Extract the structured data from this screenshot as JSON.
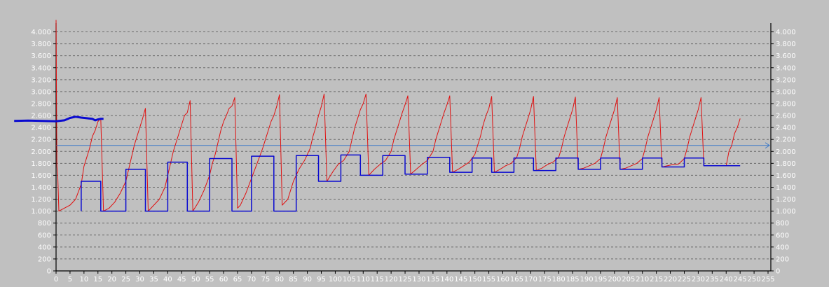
{
  "chart_data": {
    "type": "line",
    "title": "",
    "xlabel": "",
    "ylabel": "",
    "xlim": [
      0,
      256
    ],
    "ylim": [
      0,
      4100
    ],
    "grid": true,
    "x_ticks": [
      0,
      5,
      10,
      15,
      20,
      25,
      30,
      35,
      40,
      45,
      50,
      55,
      60,
      65,
      70,
      75,
      80,
      85,
      90,
      95,
      100,
      105,
      110,
      115,
      120,
      125,
      130,
      135,
      140,
      145,
      150,
      155,
      160,
      165,
      170,
      175,
      180,
      185,
      190,
      195,
      200,
      205,
      210,
      215,
      220,
      225,
      230,
      235,
      240,
      245,
      250,
      255
    ],
    "x_tick_labels": [
      "0",
      "5",
      "10",
      "15",
      "20",
      "25",
      "30",
      "35",
      "40",
      "45",
      "50",
      "55",
      "60",
      "65",
      "70",
      "75",
      "80",
      "85",
      "90",
      "95",
      "100",
      "105",
      "110",
      "115",
      "120",
      "125",
      "130",
      "135",
      "140",
      "145",
      "150",
      "155",
      "160",
      "165",
      "170",
      "175",
      "180",
      "185",
      "190",
      "195",
      "200",
      "205",
      "210",
      "215",
      "220",
      "225",
      "230",
      "235",
      "240",
      "245",
      "250",
      "255"
    ],
    "y_ticks": [
      0,
      200,
      400,
      600,
      800,
      1000,
      1200,
      1400,
      1600,
      1800,
      2000,
      2200,
      2400,
      2600,
      2800,
      3000,
      3200,
      3400,
      3600,
      3800,
      4000
    ],
    "y_tick_labels": [
      "0",
      "200",
      "400",
      "600",
      "800",
      "1.000",
      "1.200",
      "1.400",
      "1.600",
      "1.800",
      "2.000",
      "2.200",
      "2.400",
      "2.600",
      "2.800",
      "3.000",
      "3.200",
      "3.400",
      "3.600",
      "3.800",
      "4.000"
    ],
    "reference_line": {
      "y": 2100,
      "color": "#3a78c8"
    },
    "series": [
      {
        "color": "#e01010",
        "points": [
          [
            0,
            4200
          ],
          [
            0.3,
            1750
          ],
          [
            0.6,
            1600
          ],
          [
            1,
            1000
          ],
          [
            5,
            1100
          ],
          [
            7,
            1200
          ],
          [
            9,
            1450
          ],
          [
            10,
            1750
          ],
          [
            11,
            1900
          ],
          [
            12,
            2050
          ],
          [
            13,
            2250
          ],
          [
            14,
            2350
          ],
          [
            15,
            2500
          ],
          [
            16,
            2550
          ],
          [
            17,
            1000
          ],
          [
            19,
            1050
          ],
          [
            21,
            1150
          ],
          [
            23,
            1300
          ],
          [
            25,
            1500
          ],
          [
            26,
            1700
          ],
          [
            27,
            1900
          ],
          [
            28,
            2100
          ],
          [
            29,
            2250
          ],
          [
            30,
            2400
          ],
          [
            31,
            2550
          ],
          [
            32,
            2720
          ],
          [
            33,
            1000
          ],
          [
            35,
            1100
          ],
          [
            37,
            1200
          ],
          [
            39,
            1400
          ],
          [
            40,
            1600
          ],
          [
            41,
            1800
          ],
          [
            42,
            2000
          ],
          [
            43,
            2150
          ],
          [
            44,
            2300
          ],
          [
            45,
            2450
          ],
          [
            46,
            2600
          ],
          [
            47,
            2650
          ],
          [
            48,
            2850
          ],
          [
            49,
            1000
          ],
          [
            51,
            1150
          ],
          [
            53,
            1350
          ],
          [
            55,
            1600
          ],
          [
            56,
            1800
          ],
          [
            57,
            1950
          ],
          [
            58,
            2150
          ],
          [
            59,
            2350
          ],
          [
            60,
            2500
          ],
          [
            61,
            2600
          ],
          [
            62,
            2720
          ],
          [
            63,
            2760
          ],
          [
            64,
            2900
          ],
          [
            65,
            1050
          ],
          [
            66,
            1100
          ],
          [
            68,
            1300
          ],
          [
            70,
            1550
          ],
          [
            72,
            1800
          ],
          [
            74,
            2050
          ],
          [
            75,
            2200
          ],
          [
            76,
            2350
          ],
          [
            77,
            2500
          ],
          [
            78,
            2600
          ],
          [
            79,
            2750
          ],
          [
            80,
            2950
          ],
          [
            81,
            1100
          ],
          [
            83,
            1200
          ],
          [
            85,
            1500
          ],
          [
            87,
            1700
          ],
          [
            89,
            1850
          ],
          [
            91,
            2050
          ],
          [
            92,
            2250
          ],
          [
            93,
            2400
          ],
          [
            94,
            2600
          ],
          [
            95,
            2750
          ],
          [
            96,
            2960
          ],
          [
            97,
            1500
          ],
          [
            99,
            1650
          ],
          [
            101,
            1780
          ],
          [
            103,
            1850
          ],
          [
            105,
            2000
          ],
          [
            106,
            2200
          ],
          [
            107,
            2400
          ],
          [
            108,
            2550
          ],
          [
            109,
            2700
          ],
          [
            110,
            2800
          ],
          [
            111,
            2960
          ],
          [
            112,
            1600
          ],
          [
            114,
            1700
          ],
          [
            116,
            1780
          ],
          [
            118,
            1850
          ],
          [
            120,
            2000
          ],
          [
            121,
            2200
          ],
          [
            122,
            2350
          ],
          [
            123,
            2500
          ],
          [
            124,
            2650
          ],
          [
            125,
            2780
          ],
          [
            126,
            2930
          ],
          [
            127,
            1620
          ],
          [
            129,
            1700
          ],
          [
            131,
            1780
          ],
          [
            133,
            1850
          ],
          [
            135,
            2000
          ],
          [
            136,
            2200
          ],
          [
            137,
            2350
          ],
          [
            138,
            2500
          ],
          [
            139,
            2650
          ],
          [
            140,
            2780
          ],
          [
            141,
            2930
          ],
          [
            142,
            1650
          ],
          [
            144,
            1700
          ],
          [
            146,
            1760
          ],
          [
            148,
            1820
          ],
          [
            150,
            1950
          ],
          [
            151,
            2100
          ],
          [
            152,
            2250
          ],
          [
            153,
            2450
          ],
          [
            154,
            2600
          ],
          [
            155,
            2720
          ],
          [
            156,
            2920
          ],
          [
            157,
            1650
          ],
          [
            159,
            1700
          ],
          [
            161,
            1760
          ],
          [
            163,
            1800
          ],
          [
            165,
            1900
          ],
          [
            166,
            2050
          ],
          [
            167,
            2250
          ],
          [
            168,
            2400
          ],
          [
            169,
            2550
          ],
          [
            170,
            2700
          ],
          [
            171,
            2920
          ],
          [
            172,
            1680
          ],
          [
            174,
            1720
          ],
          [
            176,
            1780
          ],
          [
            178,
            1820
          ],
          [
            180,
            1900
          ],
          [
            181,
            2050
          ],
          [
            182,
            2250
          ],
          [
            183,
            2400
          ],
          [
            184,
            2550
          ],
          [
            185,
            2700
          ],
          [
            186,
            2910
          ],
          [
            187,
            1700
          ],
          [
            189,
            1720
          ],
          [
            191,
            1760
          ],
          [
            193,
            1800
          ],
          [
            195,
            1880
          ],
          [
            196,
            2050
          ],
          [
            197,
            2250
          ],
          [
            198,
            2400
          ],
          [
            199,
            2550
          ],
          [
            200,
            2700
          ],
          [
            201,
            2900
          ],
          [
            202,
            1700
          ],
          [
            204,
            1720
          ],
          [
            206,
            1760
          ],
          [
            208,
            1800
          ],
          [
            210,
            1880
          ],
          [
            211,
            2050
          ],
          [
            212,
            2250
          ],
          [
            213,
            2400
          ],
          [
            214,
            2550
          ],
          [
            215,
            2700
          ],
          [
            216,
            2900
          ],
          [
            217,
            1740
          ],
          [
            219,
            1760
          ],
          [
            221,
            1780
          ],
          [
            223,
            1790
          ],
          [
            225,
            1880
          ],
          [
            226,
            2050
          ],
          [
            227,
            2250
          ],
          [
            228,
            2400
          ],
          [
            229,
            2550
          ],
          [
            230,
            2700
          ],
          [
            231,
            2900
          ],
          [
            232,
            1760
          ],
          [
            240,
            1760
          ],
          [
            241,
            2000
          ],
          [
            242,
            2100
          ],
          [
            243,
            2300
          ],
          [
            244,
            2400
          ],
          [
            245,
            2550
          ]
        ]
      },
      {
        "color": "#0a0ad0",
        "points": [
          [
            9,
            1000
          ],
          [
            9,
            1500
          ],
          [
            16,
            1500
          ],
          [
            16,
            1000
          ],
          [
            25,
            1000
          ],
          [
            25,
            1700
          ],
          [
            32,
            1700
          ],
          [
            32,
            1000
          ],
          [
            40,
            1000
          ],
          [
            40,
            1820
          ],
          [
            47,
            1820
          ],
          [
            47,
            1000
          ],
          [
            55,
            1000
          ],
          [
            55,
            1880
          ],
          [
            63,
            1880
          ],
          [
            63,
            1000
          ],
          [
            70,
            1000
          ],
          [
            70,
            1920
          ],
          [
            78,
            1920
          ],
          [
            78,
            1000
          ],
          [
            86,
            1000
          ],
          [
            86,
            1930
          ],
          [
            94,
            1930
          ],
          [
            94,
            1500
          ],
          [
            102,
            1500
          ],
          [
            102,
            1940
          ],
          [
            109,
            1940
          ],
          [
            109,
            1600
          ],
          [
            117,
            1600
          ],
          [
            117,
            1930
          ],
          [
            125,
            1930
          ],
          [
            125,
            1620
          ],
          [
            133,
            1620
          ],
          [
            133,
            1900
          ],
          [
            141,
            1900
          ],
          [
            141,
            1650
          ],
          [
            149,
            1650
          ],
          [
            149,
            1890
          ],
          [
            156,
            1890
          ],
          [
            156,
            1650
          ],
          [
            164,
            1650
          ],
          [
            164,
            1890
          ],
          [
            171,
            1890
          ],
          [
            171,
            1680
          ],
          [
            179,
            1680
          ],
          [
            179,
            1890
          ],
          [
            187,
            1890
          ],
          [
            187,
            1700
          ],
          [
            195,
            1700
          ],
          [
            195,
            1890
          ],
          [
            202,
            1890
          ],
          [
            202,
            1700
          ],
          [
            210,
            1700
          ],
          [
            210,
            1890
          ],
          [
            217,
            1890
          ],
          [
            217,
            1740
          ],
          [
            225,
            1740
          ],
          [
            225,
            1890
          ],
          [
            232,
            1890
          ],
          [
            232,
            1760
          ],
          [
            245,
            1760
          ]
        ]
      },
      {
        "color": "#0a0ad0",
        "points": [
          [
            -15,
            2510
          ],
          [
            -10,
            2515
          ],
          [
            -5,
            2510
          ],
          [
            0,
            2505
          ],
          [
            3,
            2520
          ],
          [
            5,
            2560
          ],
          [
            7,
            2580
          ],
          [
            9,
            2565
          ],
          [
            11,
            2555
          ],
          [
            13,
            2545
          ],
          [
            14,
            2520
          ],
          [
            15,
            2535
          ],
          [
            16,
            2545
          ],
          [
            17,
            2545
          ]
        ]
      }
    ]
  }
}
